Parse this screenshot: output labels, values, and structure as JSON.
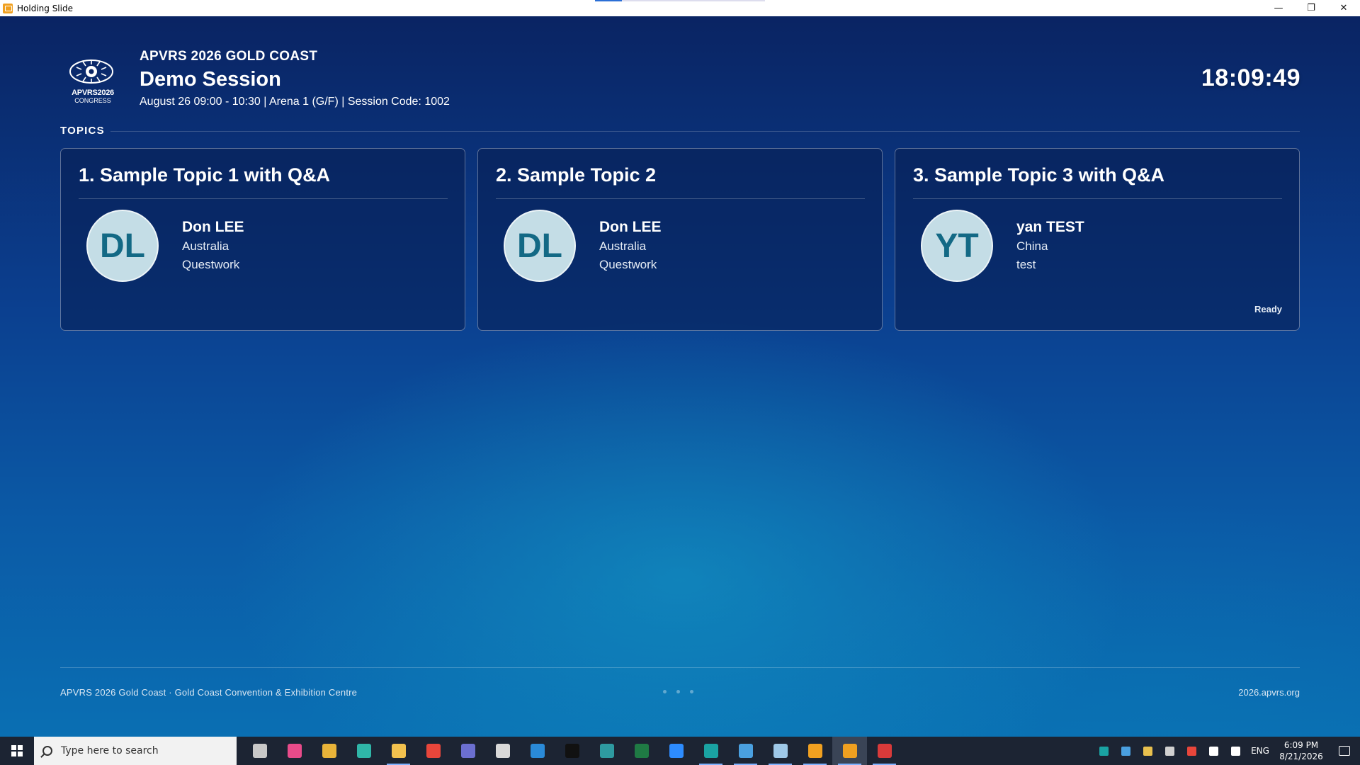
{
  "window": {
    "title": "Holding Slide",
    "loading_progress": 0.16,
    "controls": {
      "minimize": "—",
      "restore": "❐",
      "close": "✕"
    }
  },
  "header": {
    "logo": {
      "text": "APVRS2026",
      "sub": "CONGRESS"
    },
    "event_name": "APVRS 2026 GOLD COAST",
    "session_title": "Demo Session",
    "session_meta": "August 26 09:00 - 10:30 | Arena 1 (G/F) | Session Code: 1002",
    "clock": "18:09:49"
  },
  "topics": {
    "label": "TOPICS",
    "items": [
      {
        "title": "1. Sample Topic 1 with Q&A",
        "initials": "DL",
        "speaker": "Don LEE",
        "country": "Australia",
        "org": "Questwork",
        "status": ""
      },
      {
        "title": "2. Sample Topic 2",
        "initials": "DL",
        "speaker": "Don LEE",
        "country": "Australia",
        "org": "Questwork",
        "status": ""
      },
      {
        "title": "3. Sample Topic 3 with Q&A",
        "initials": "YT",
        "speaker": "yan TEST",
        "country": "China",
        "org": "test",
        "status": "Ready"
      }
    ]
  },
  "footer": {
    "left": "APVRS 2026 Gold Coast · Gold Coast Convention & Exhibition Centre",
    "right": "2026.apvrs.org",
    "page_dots": 3
  },
  "taskbar": {
    "search_placeholder": "Type here to search",
    "apps": [
      {
        "name": "task-view-icon",
        "color": "#c8c8c8"
      },
      {
        "name": "paint-app-icon",
        "color": "#e84b8a"
      },
      {
        "name": "chrome-icon",
        "color": "#e8b339"
      },
      {
        "name": "edge-icon",
        "color": "#2fb6a8"
      },
      {
        "name": "file-explorer-icon",
        "color": "#f2c14e"
      },
      {
        "name": "anydesk-icon",
        "color": "#e8463b"
      },
      {
        "name": "teams-icon",
        "color": "#6b6fd0"
      },
      {
        "name": "settings-icon",
        "color": "#d9d9d9"
      },
      {
        "name": "vscode-icon",
        "color": "#2a8ad8"
      },
      {
        "name": "terminal-icon",
        "color": "#111111"
      },
      {
        "name": "ssh-client-icon",
        "color": "#2e9aa0"
      },
      {
        "name": "excel-icon",
        "color": "#1f7a44"
      },
      {
        "name": "zoom-icon",
        "color": "#2d8cff"
      },
      {
        "name": "media-app-icon",
        "color": "#1aa3a3"
      },
      {
        "name": "remote-desktop-icon",
        "color": "#4aa0e0"
      },
      {
        "name": "notes-app-icon",
        "color": "#9ec8e8"
      },
      {
        "name": "bookmark-app-icon",
        "color": "#f0a020"
      },
      {
        "name": "holding-slide-icon",
        "color": "#f0a020"
      },
      {
        "name": "snipping-tool-icon",
        "color": "#d83a3a"
      }
    ],
    "tray": {
      "icons": [
        "app-tray-icon",
        "sync-icon",
        "security-icon",
        "bluetooth-icon",
        "anydesk-tray-icon",
        "network-icon",
        "volume-muted-icon"
      ],
      "language": "ENG",
      "time": "6:09 PM",
      "date": "8/21/2026"
    }
  }
}
